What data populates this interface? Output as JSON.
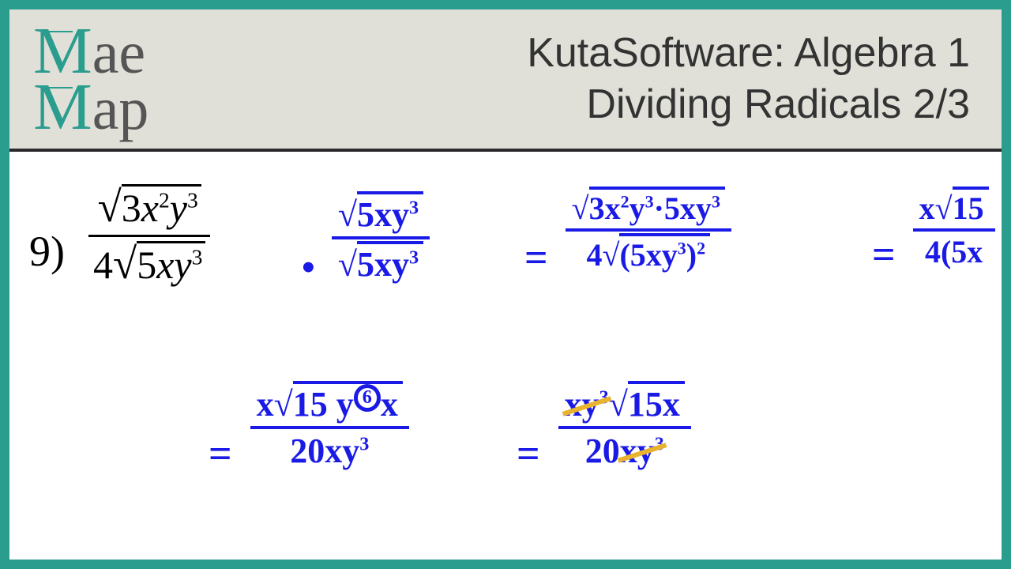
{
  "header": {
    "logo_line1_letter": "M",
    "logo_line1_rest": "ae",
    "logo_line2_letter": "M",
    "logo_line2_rest": "ap",
    "title_line1": "KutaSoftware: Algebra 1",
    "title_line2": "Dividing Radicals 2/3"
  },
  "problem": {
    "number": "9)",
    "printed_numerator": "3x²y³",
    "printed_denom_coeff": "4",
    "printed_denom_radicand": "5xy³",
    "step1_num": "5xy³",
    "step1_den": "5xy³",
    "step2_num": "3x²y³·5xy³",
    "step2_den_coeff": "4",
    "step2_den_radicand": "(5xy³)²",
    "step3_num_coeff": "x",
    "step3_num_radicand": "15",
    "step3_den": "4(5x",
    "step4_num_coeff": "x",
    "step4_num_radicand_a": "15 y",
    "step4_exp_circled": "6",
    "step4_num_radicand_b": "x",
    "step4_den": "20xy³",
    "step5_num_a": "xy³",
    "step5_num_radicand": "15x",
    "step5_den_coeff": "20",
    "step5_den_xy": "xy³"
  }
}
